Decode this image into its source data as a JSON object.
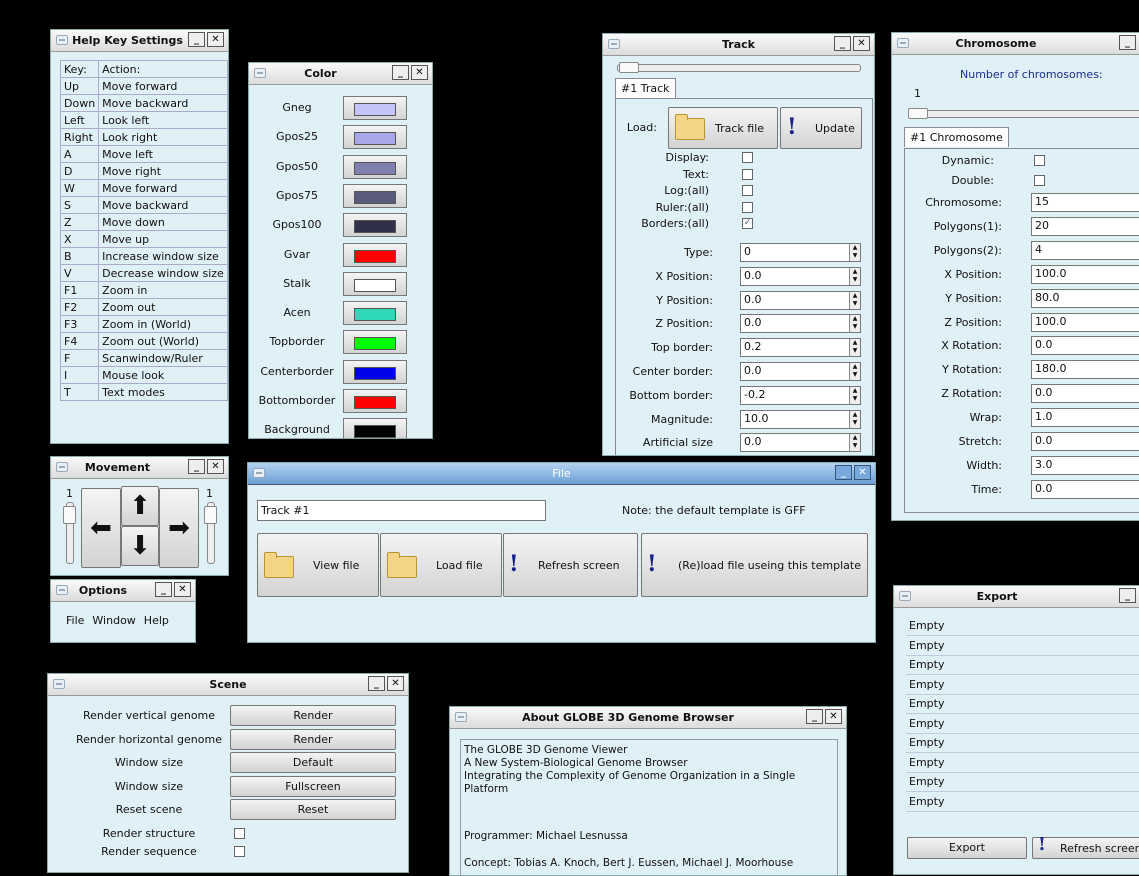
{
  "help_key": {
    "title": "Help Key Settings",
    "header": [
      "Key:",
      "Action:"
    ],
    "rows": [
      [
        "Up",
        "Move forward"
      ],
      [
        "Down",
        "Move backward"
      ],
      [
        "Left",
        "Look left"
      ],
      [
        "Right",
        "Look right"
      ],
      [
        "A",
        "Move left"
      ],
      [
        "D",
        "Move right"
      ],
      [
        "W",
        "Move forward"
      ],
      [
        "S",
        "Move backward"
      ],
      [
        "Z",
        "Move down"
      ],
      [
        "X",
        "Move up"
      ],
      [
        "B",
        "Increase window size"
      ],
      [
        "V",
        "Decrease window size"
      ],
      [
        "F1",
        "Zoom in"
      ],
      [
        "F2",
        "Zoom out"
      ],
      [
        "F3",
        "Zoom in (World)"
      ],
      [
        "F4",
        "Zoom out (World)"
      ],
      [
        "F",
        "Scanwindow/Ruler"
      ],
      [
        "I",
        "Mouse look"
      ],
      [
        "T",
        "Text modes"
      ]
    ]
  },
  "color": {
    "title": "Color",
    "items": [
      {
        "label": "Gneg",
        "color": "#c4c4f8"
      },
      {
        "label": "Gpos25",
        "color": "#a8a8e8"
      },
      {
        "label": "Gpos50",
        "color": "#8080b0"
      },
      {
        "label": "Gpos75",
        "color": "#5a5a7a"
      },
      {
        "label": "Gpos100",
        "color": "#30304a"
      },
      {
        "label": "Gvar",
        "color": "#ff0000"
      },
      {
        "label": "Stalk",
        "color": "#ffffff"
      },
      {
        "label": "Acen",
        "color": "#2ed8b8"
      },
      {
        "label": "Topborder",
        "color": "#00ff00"
      },
      {
        "label": "Centerborder",
        "color": "#0000e8"
      },
      {
        "label": "Bottomborder",
        "color": "#ff0000"
      },
      {
        "label": "Background",
        "color": "#000000"
      }
    ]
  },
  "track": {
    "title": "Track",
    "tab": "#1 Track",
    "load_label": "Load:",
    "track_file": "Track file",
    "update": "Update",
    "checks": [
      {
        "label": "Display:",
        "checked": false
      },
      {
        "label": "Text:",
        "checked": false
      },
      {
        "label": "Log:(all)",
        "checked": false
      },
      {
        "label": "Ruler:(all)",
        "checked": false
      },
      {
        "label": "Borders:(all)",
        "checked": true
      }
    ],
    "fields": [
      {
        "label": "Type:",
        "value": "0"
      },
      {
        "label": "X Position:",
        "value": "0.0"
      },
      {
        "label": "Y Position:",
        "value": "0.0"
      },
      {
        "label": "Z Position:",
        "value": "0.0"
      },
      {
        "label": "Top border:",
        "value": "0.2"
      },
      {
        "label": "Center border:",
        "value": "0.0"
      },
      {
        "label": "Bottom border:",
        "value": "-0.2"
      },
      {
        "label": "Magnitude:",
        "value": "10.0"
      },
      {
        "label": "Artificial size",
        "value": "0.0"
      }
    ]
  },
  "chromosome": {
    "title": "Chromosome",
    "count_label": "Number of chromosomes:",
    "slider_value": "1",
    "tab": "#1 Chromosome",
    "checks": [
      {
        "label": "Dynamic:",
        "checked": false
      },
      {
        "label": "Double:",
        "checked": false
      }
    ],
    "fields": [
      {
        "label": "Chromosome:",
        "value": "15"
      },
      {
        "label": "Polygons(1):",
        "value": "20"
      },
      {
        "label": "Polygons(2):",
        "value": "4"
      },
      {
        "label": "X Position:",
        "value": "100.0"
      },
      {
        "label": "Y Position:",
        "value": "80.0"
      },
      {
        "label": "Z Position:",
        "value": "100.0"
      },
      {
        "label": "X Rotation:",
        "value": "0.0"
      },
      {
        "label": "Y Rotation:",
        "value": "180.0"
      },
      {
        "label": "Z Rotation:",
        "value": "0.0"
      },
      {
        "label": "Wrap:",
        "value": "1.0"
      },
      {
        "label": "Stretch:",
        "value": "0.0"
      },
      {
        "label": "Width:",
        "value": "3.0"
      },
      {
        "label": "Time:",
        "value": "0.0"
      }
    ]
  },
  "movement": {
    "title": "Movement",
    "left_value": "1",
    "right_value": "1"
  },
  "options": {
    "title": "Options",
    "menu": [
      "File",
      "Window",
      "Help"
    ]
  },
  "file": {
    "title": "File",
    "input_value": "Track #1",
    "note": "Note: the default template is GFF",
    "view": "View file",
    "load": "Load file",
    "refresh": "Refresh screen",
    "reload": "(Re)load file useing this template"
  },
  "scene": {
    "title": "Scene",
    "rows": [
      {
        "label": "Render vertical genome",
        "button": "Render"
      },
      {
        "label": "Render horizontal genome",
        "button": "Render"
      },
      {
        "label": "Window size",
        "button": "Default"
      },
      {
        "label": "Window size",
        "button": "Fullscreen"
      },
      {
        "label": "Reset scene",
        "button": "Reset"
      }
    ],
    "checks": [
      {
        "label": "Render structure",
        "checked": false
      },
      {
        "label": "Render sequence",
        "checked": false
      }
    ]
  },
  "about": {
    "title": "About GLOBE 3D Genome Browser",
    "lines": [
      "The GLOBE 3D Genome Viewer",
      "A New System-Biological Genome Browser",
      "Integrating the Complexity of Genome Organization in a Single Platform"
    ],
    "programmer": "Programmer: Michael Lesnussa",
    "concept": "Concept: Tobias A. Knoch, Bert J. Eussen, Michael J. Moorhouse"
  },
  "export": {
    "title": "Export",
    "items": [
      "Empty",
      "Empty",
      "Empty",
      "Empty",
      "Empty",
      "Empty",
      "Empty",
      "Empty",
      "Empty",
      "Empty"
    ],
    "export_btn": "Export",
    "refresh_btn": "Refresh screen"
  }
}
